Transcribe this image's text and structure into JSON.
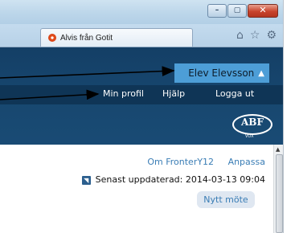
{
  "window": {
    "buttons": [
      "–",
      "▢",
      "✕"
    ]
  },
  "tab": {
    "label": "Alvis från Gotit"
  },
  "toolbar_icons": [
    "home-icon",
    "star-icon",
    "gear-icon"
  ],
  "header": {
    "user_name": "Elev Elevsson",
    "caret": "▲",
    "nav": {
      "profile": "Min profil",
      "help": "Hjälp",
      "logout": "Logga ut"
    },
    "logo_text": "ABF",
    "logo_sub": "VUX"
  },
  "content": {
    "links": {
      "about": "Om FronterY12",
      "customize": "Anpassa"
    },
    "updated": "Senast uppdaterad: 2014-03-13 09:04",
    "new_meeting": "Nytt möte"
  },
  "colors": {
    "header_bg": "#17476f",
    "user_button": "#4d9ed7",
    "link": "#3a7db5"
  }
}
